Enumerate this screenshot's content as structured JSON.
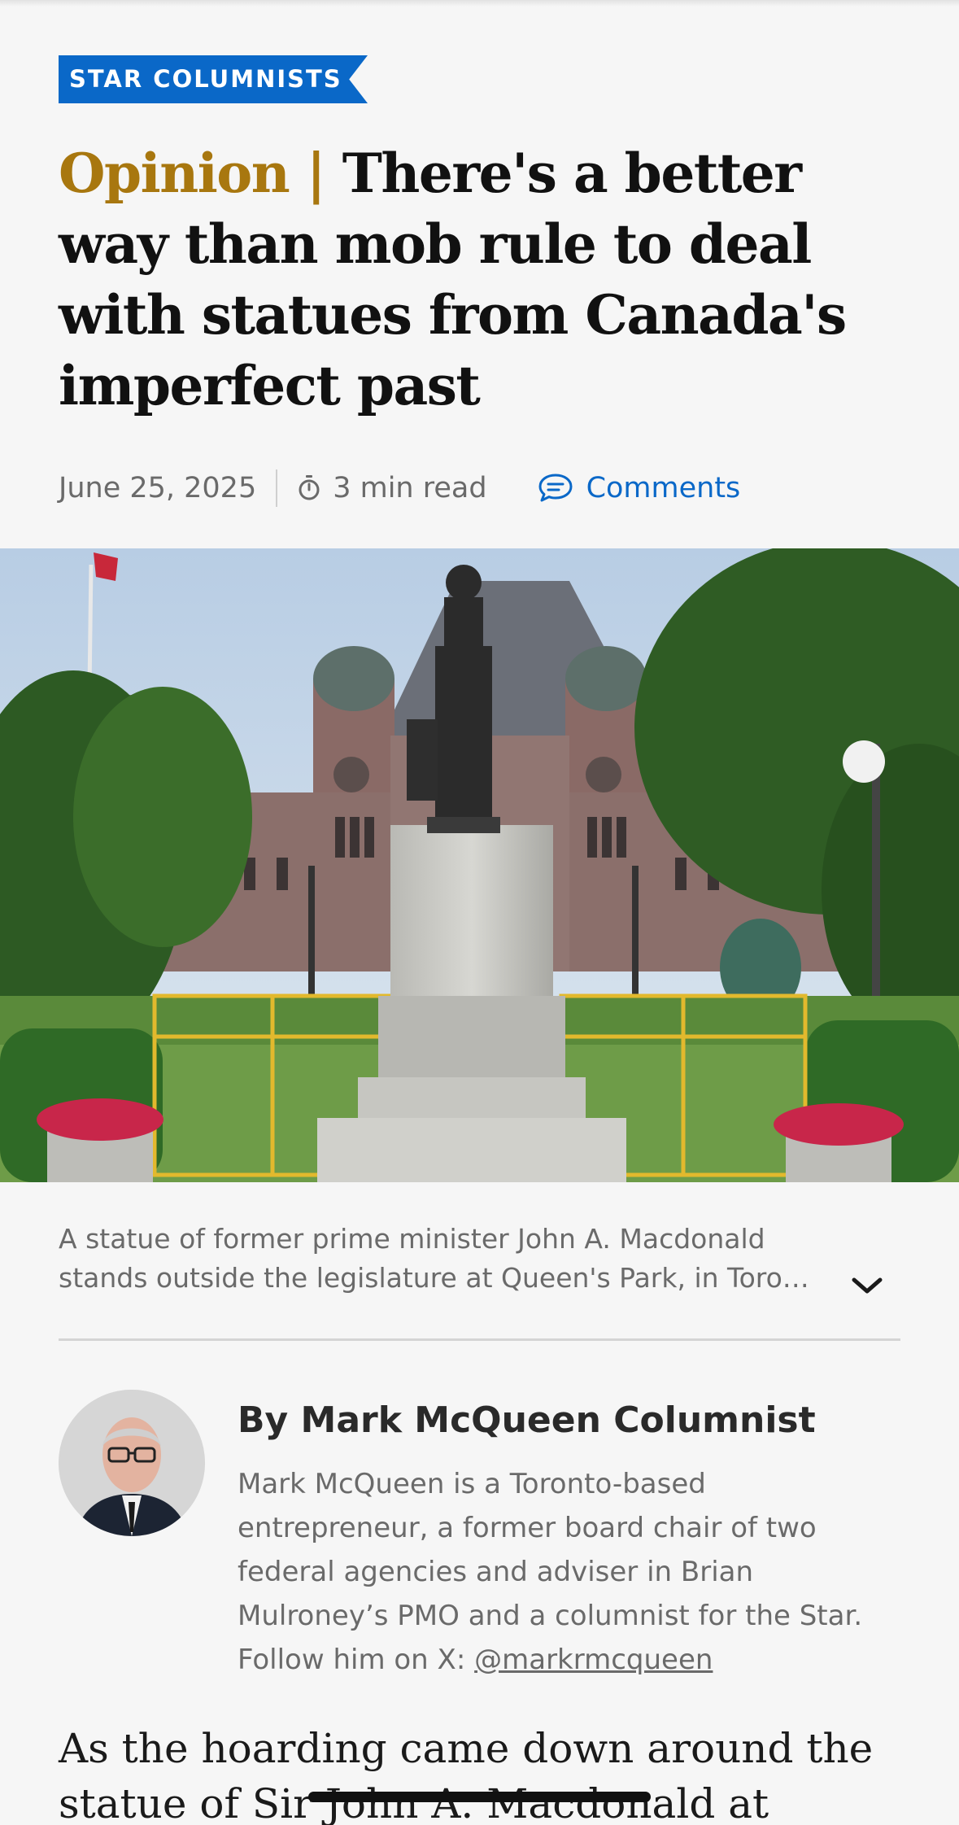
{
  "section_tag": "STAR COLUMNISTS",
  "headline": {
    "label": "Opinion |",
    "title": "There's a better way than mob rule to deal with statues from Canada's imperfect past"
  },
  "meta": {
    "date": "June 25, 2025",
    "read_time": "3 min read",
    "comments_label": "Comments"
  },
  "photo": {
    "caption_line1": "A statue of former prime minister John A. Macdonald",
    "caption_line2": "stands outside the legislature at Queen's Park, in Toro…"
  },
  "author": {
    "byline": "By Mark McQueen Columnist",
    "bio": "Mark McQueen is a Toronto-based entrepreneur, a former board chair of two federal agencies and adviser in Brian Mulroney’s PMO and a columnist for the Star. Follow him on X:",
    "handle": "@markrmcqueen"
  },
  "article": {
    "first_paragraph": "As the hoarding came down around the statue of Sir John A. Macdonald at"
  },
  "colors": {
    "accent_blue": "#0a68c8",
    "opinion_gold": "#a8770f"
  }
}
